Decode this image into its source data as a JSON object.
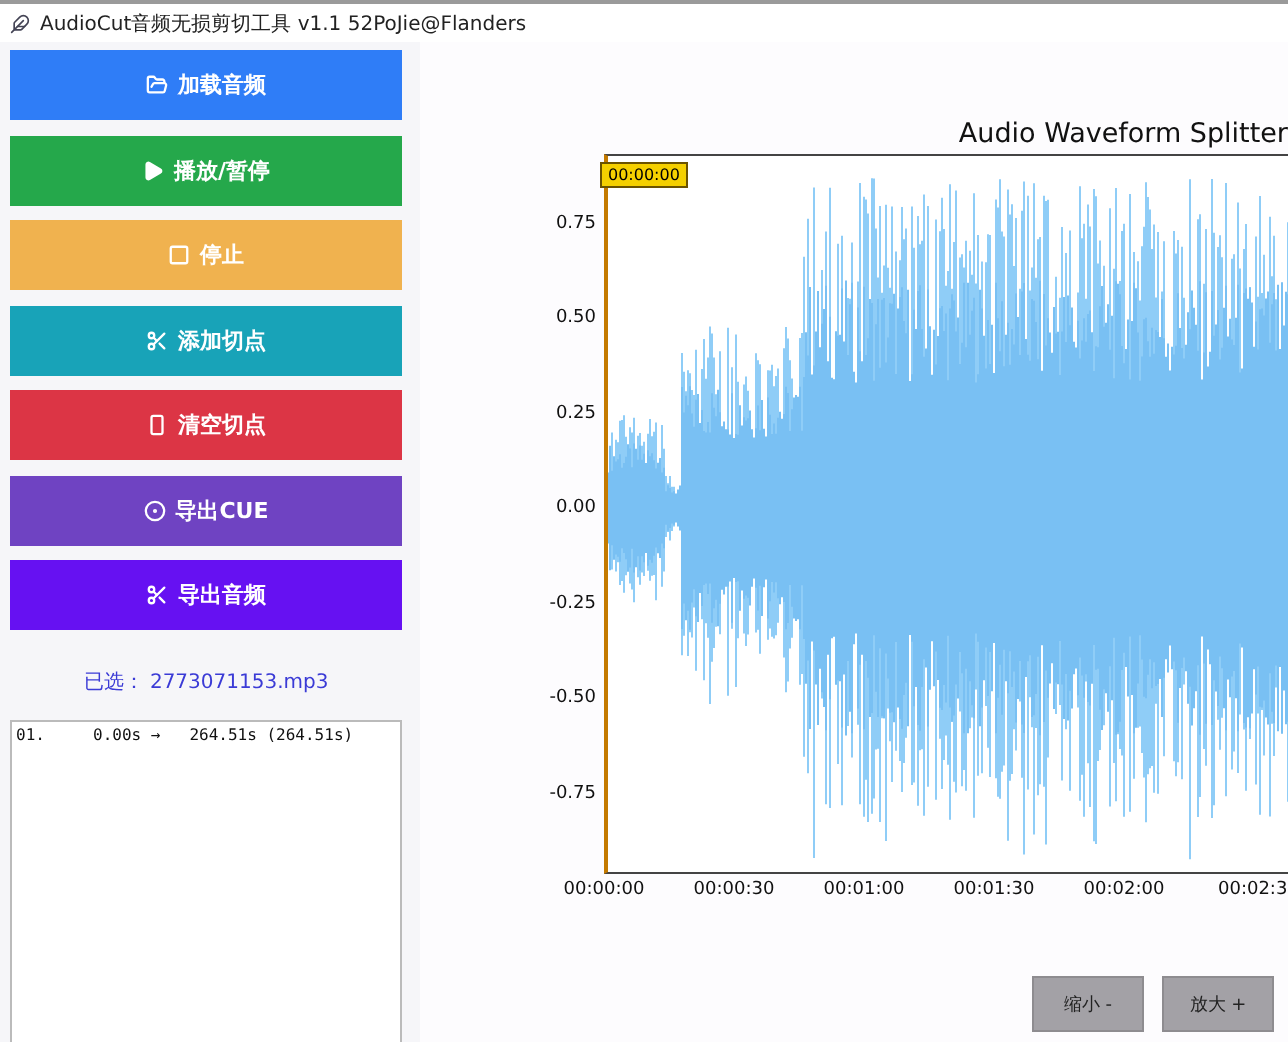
{
  "window": {
    "title": "AudioCut音频无损剪切工具 v1.1 52PoJie@Flanders"
  },
  "buttons": [
    {
      "label": "加载音频",
      "kind": "load",
      "color": "#2f7df7"
    },
    {
      "label": "播放/暂停",
      "kind": "play",
      "color": "#25a84b"
    },
    {
      "label": "停止",
      "kind": "stop",
      "color": "#f0b24f"
    },
    {
      "label": "添加切点",
      "kind": "cut",
      "color": "#18a3b8"
    },
    {
      "label": "清空切点",
      "kind": "clear",
      "color": "#dc3545"
    },
    {
      "label": "导出CUE",
      "kind": "cue",
      "color": "#6f43c2"
    },
    {
      "label": "导出音频",
      "kind": "export",
      "color": "#6611f2"
    }
  ],
  "selected_file": "已选：  2773071153.mp3",
  "cut_list": [
    "01.     0.00s →   264.51s (264.51s)"
  ],
  "chart": {
    "title": "Audio Waveform Splitter",
    "time_marker": "00:00:00",
    "y_ticks": [
      "0.75",
      "0.50",
      "0.25",
      "0.00",
      "-0.25",
      "-0.50",
      "-0.75"
    ],
    "x_ticks": [
      "00:00:00",
      "00:00:30",
      "00:01:00",
      "00:01:30",
      "00:02:00",
      "00:02:3"
    ]
  },
  "zoom_buttons": [
    "缩小 -",
    "放大 +"
  ]
}
